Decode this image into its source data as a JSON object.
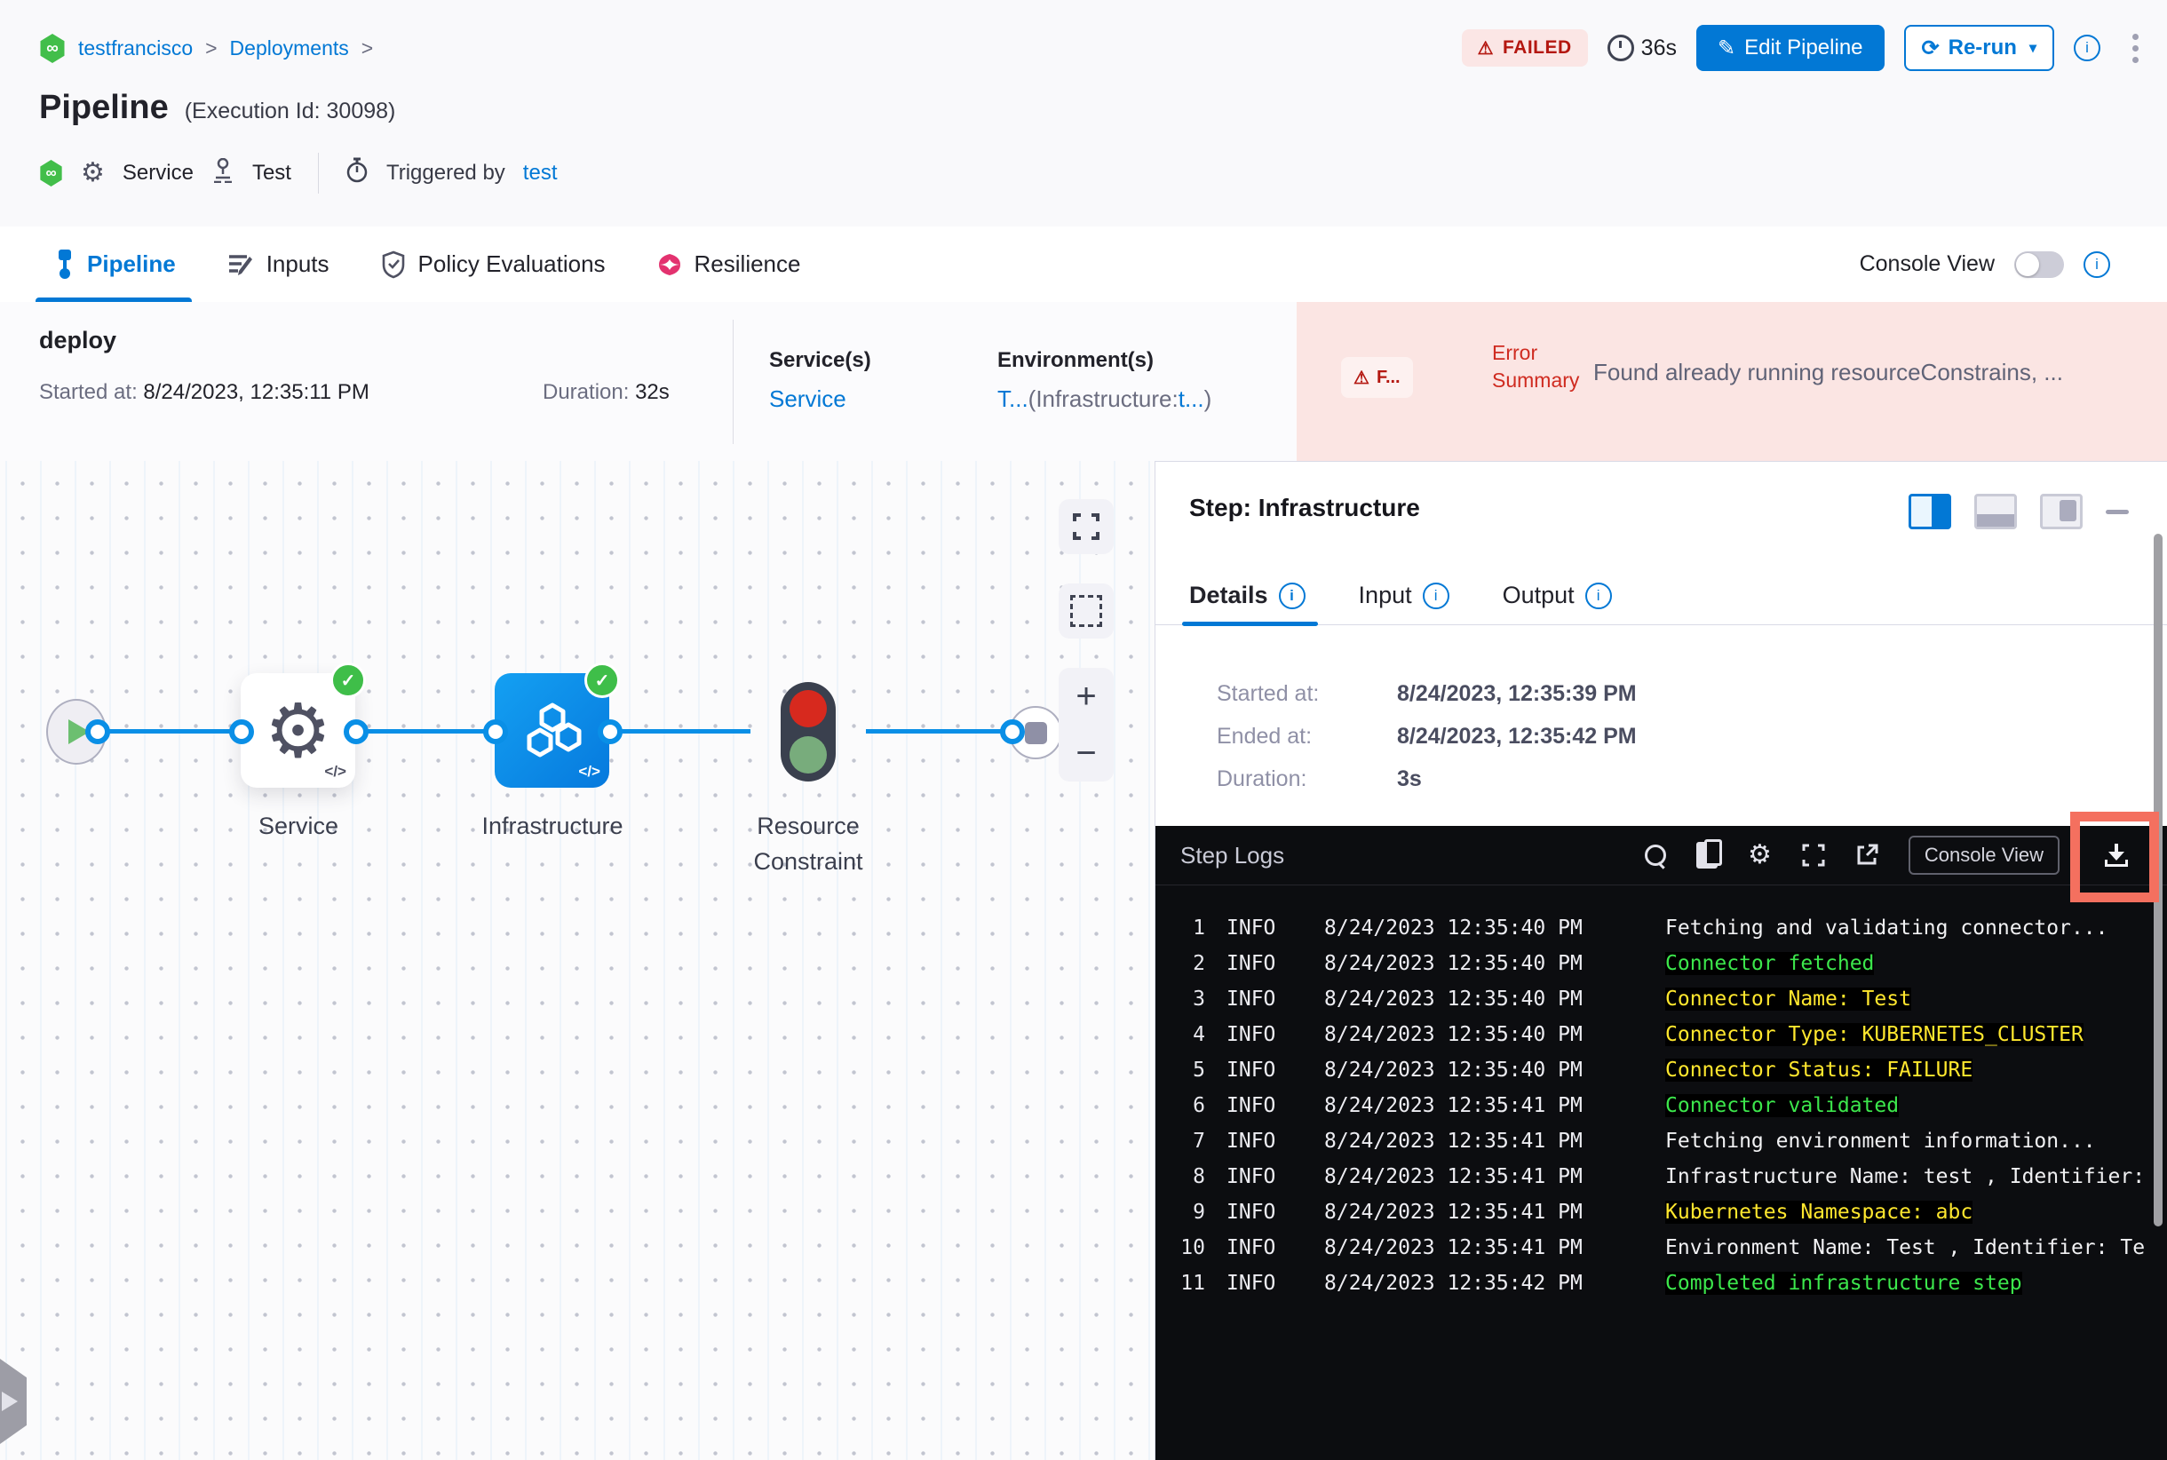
{
  "breadcrumb": {
    "project": "testfrancisco",
    "section": "Deployments",
    "separator": ">"
  },
  "header": {
    "title": "Pipeline",
    "execution_id": "(Execution Id: 30098)",
    "status_badge": "FAILED",
    "elapsed": "36s",
    "edit_button": "Edit Pipeline",
    "rerun_button": "Re-run",
    "service_label": "Service",
    "test_label": "Test",
    "triggered_by_label": "Triggered by",
    "triggered_by_value": "test"
  },
  "tabs": [
    {
      "label": "Pipeline",
      "active": true
    },
    {
      "label": "Inputs",
      "active": false
    },
    {
      "label": "Policy Evaluations",
      "active": false
    },
    {
      "label": "Resilience",
      "active": false
    }
  ],
  "console_view_label": "Console View",
  "stage_summary": {
    "name": "deploy",
    "started_label": "Started at: ",
    "started_value": "8/24/2023, 12:35:11 PM",
    "duration_label": "Duration: ",
    "duration_value": "32s",
    "services_label": "Service(s)",
    "services_value": "Service",
    "environments_label": "Environment(s)",
    "env_v1": "T...",
    "env_v2": "(Infrastructure:",
    "env_v3": "t...",
    "env_v4": ")",
    "error_badge": "F...",
    "error_label": "Error Summary",
    "error_message": "Found already running resourceConstrains, ..."
  },
  "graph": {
    "nodes": [
      {
        "label": "Service"
      },
      {
        "label": "Infrastructure"
      },
      {
        "label": "Resource Constraint"
      }
    ]
  },
  "step_panel": {
    "title": "Step: Infrastructure",
    "tabs": [
      {
        "label": "Details",
        "active": true
      },
      {
        "label": "Input",
        "active": false
      },
      {
        "label": "Output",
        "active": false
      }
    ],
    "details": {
      "started_label": "Started at:",
      "started_value": "8/24/2023, 12:35:39 PM",
      "ended_label": "Ended at:",
      "ended_value": "8/24/2023, 12:35:42 PM",
      "duration_label": "Duration:",
      "duration_value": "3s"
    }
  },
  "logs": {
    "title": "Step Logs",
    "console_view_button": "Console View",
    "lines": [
      {
        "n": "1",
        "level": "INFO",
        "time": "8/24/2023 12:35:40 PM",
        "msg": "Fetching and validating connector...",
        "color": "white"
      },
      {
        "n": "2",
        "level": "INFO",
        "time": "8/24/2023 12:35:40 PM",
        "msg": "Connector fetched",
        "color": "green"
      },
      {
        "n": "3",
        "level": "INFO",
        "time": "8/24/2023 12:35:40 PM",
        "msg": "Connector Name: Test",
        "color": "yellow"
      },
      {
        "n": "4",
        "level": "INFO",
        "time": "8/24/2023 12:35:40 PM",
        "msg": "Connector Type: KUBERNETES_CLUSTER",
        "color": "yellow"
      },
      {
        "n": "5",
        "level": "INFO",
        "time": "8/24/2023 12:35:40 PM",
        "msg": "Connector Status: FAILURE",
        "color": "yellow"
      },
      {
        "n": "6",
        "level": "INFO",
        "time": "8/24/2023 12:35:41 PM",
        "msg": "Connector validated",
        "color": "green"
      },
      {
        "n": "7",
        "level": "INFO",
        "time": "8/24/2023 12:35:41 PM",
        "msg": "Fetching environment information...",
        "color": "white"
      },
      {
        "n": "8",
        "level": "INFO",
        "time": "8/24/2023 12:35:41 PM",
        "msg": "Infrastructure Name: test , Identifier:",
        "color": "white"
      },
      {
        "n": "9",
        "level": "INFO",
        "time": "8/24/2023 12:35:41 PM",
        "msg": "Kubernetes Namespace: abc",
        "color": "yellow"
      },
      {
        "n": "10",
        "level": "INFO",
        "time": "8/24/2023 12:35:41 PM",
        "msg": "Environment Name: Test , Identifier: Te",
        "color": "white"
      },
      {
        "n": "11",
        "level": "INFO",
        "time": "8/24/2023 12:35:42 PM",
        "msg": "Completed infrastructure step",
        "color": "green"
      }
    ]
  },
  "icons": {
    "infinity": "∞",
    "gear": "⚙",
    "warning": "⚠",
    "check": "✓",
    "pencil": "✎",
    "refresh": "⟳",
    "caret": "▾",
    "code": "</>",
    "plus": "+",
    "minus": "−"
  },
  "colors": {
    "accent_blue": "#0278D5",
    "node_blue": "#0A8FE6",
    "success_green": "#3FBE49",
    "failed_red": "#B41710",
    "error_bg": "#FBE5E3",
    "log_green": "#3CE74C",
    "log_yellow": "#FFE72E",
    "highlight_red": "#F4705F",
    "resilience_pink": "#E3326F"
  }
}
